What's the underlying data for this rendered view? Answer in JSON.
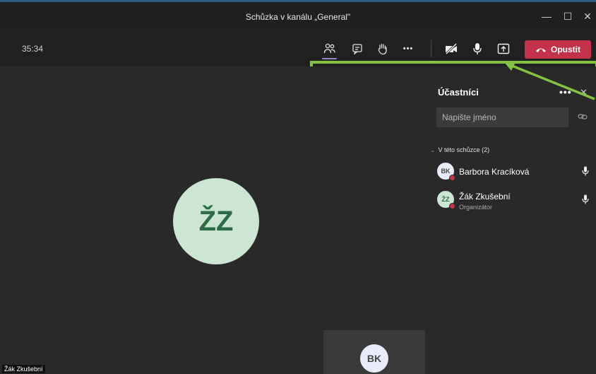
{
  "window": {
    "ghost_title": "",
    "title": "Schůzka v kanálu „General\"",
    "controls": [
      "—",
      "☐",
      "✕"
    ]
  },
  "toolbar": {
    "timer": "35:34",
    "icons": [
      "participants-icon",
      "chat-icon",
      "raise-hand-icon",
      "more-icon",
      "camera-off-icon",
      "microphone-icon",
      "share-screen-icon"
    ],
    "more_label": "•••",
    "leave_label": "Opustit"
  },
  "stage": {
    "main_avatar_initials": "ŽZ",
    "self_avatar_initials": "BK",
    "name_tag": "Žák Zkušební"
  },
  "participants_panel": {
    "title": "Účastníci",
    "more_label": "•••",
    "close_label": "✕",
    "search_placeholder": "Napište jméno",
    "section_label": "V této schůzce (2)",
    "people": [
      {
        "initials": "BK",
        "name": "Barbora Kracíková",
        "role": "",
        "avatar_bg": "#e8ebfa",
        "avatar_fg": "#444444"
      },
      {
        "initials": "ŽZ",
        "name": "Žák Zkušební",
        "role": "Organizátor",
        "avatar_bg": "#cce6d3",
        "avatar_fg": "#2f6b45"
      }
    ]
  },
  "colors": {
    "accent": "#8b8cc7",
    "leave": "#c4314b",
    "highlight": "#84c341"
  }
}
